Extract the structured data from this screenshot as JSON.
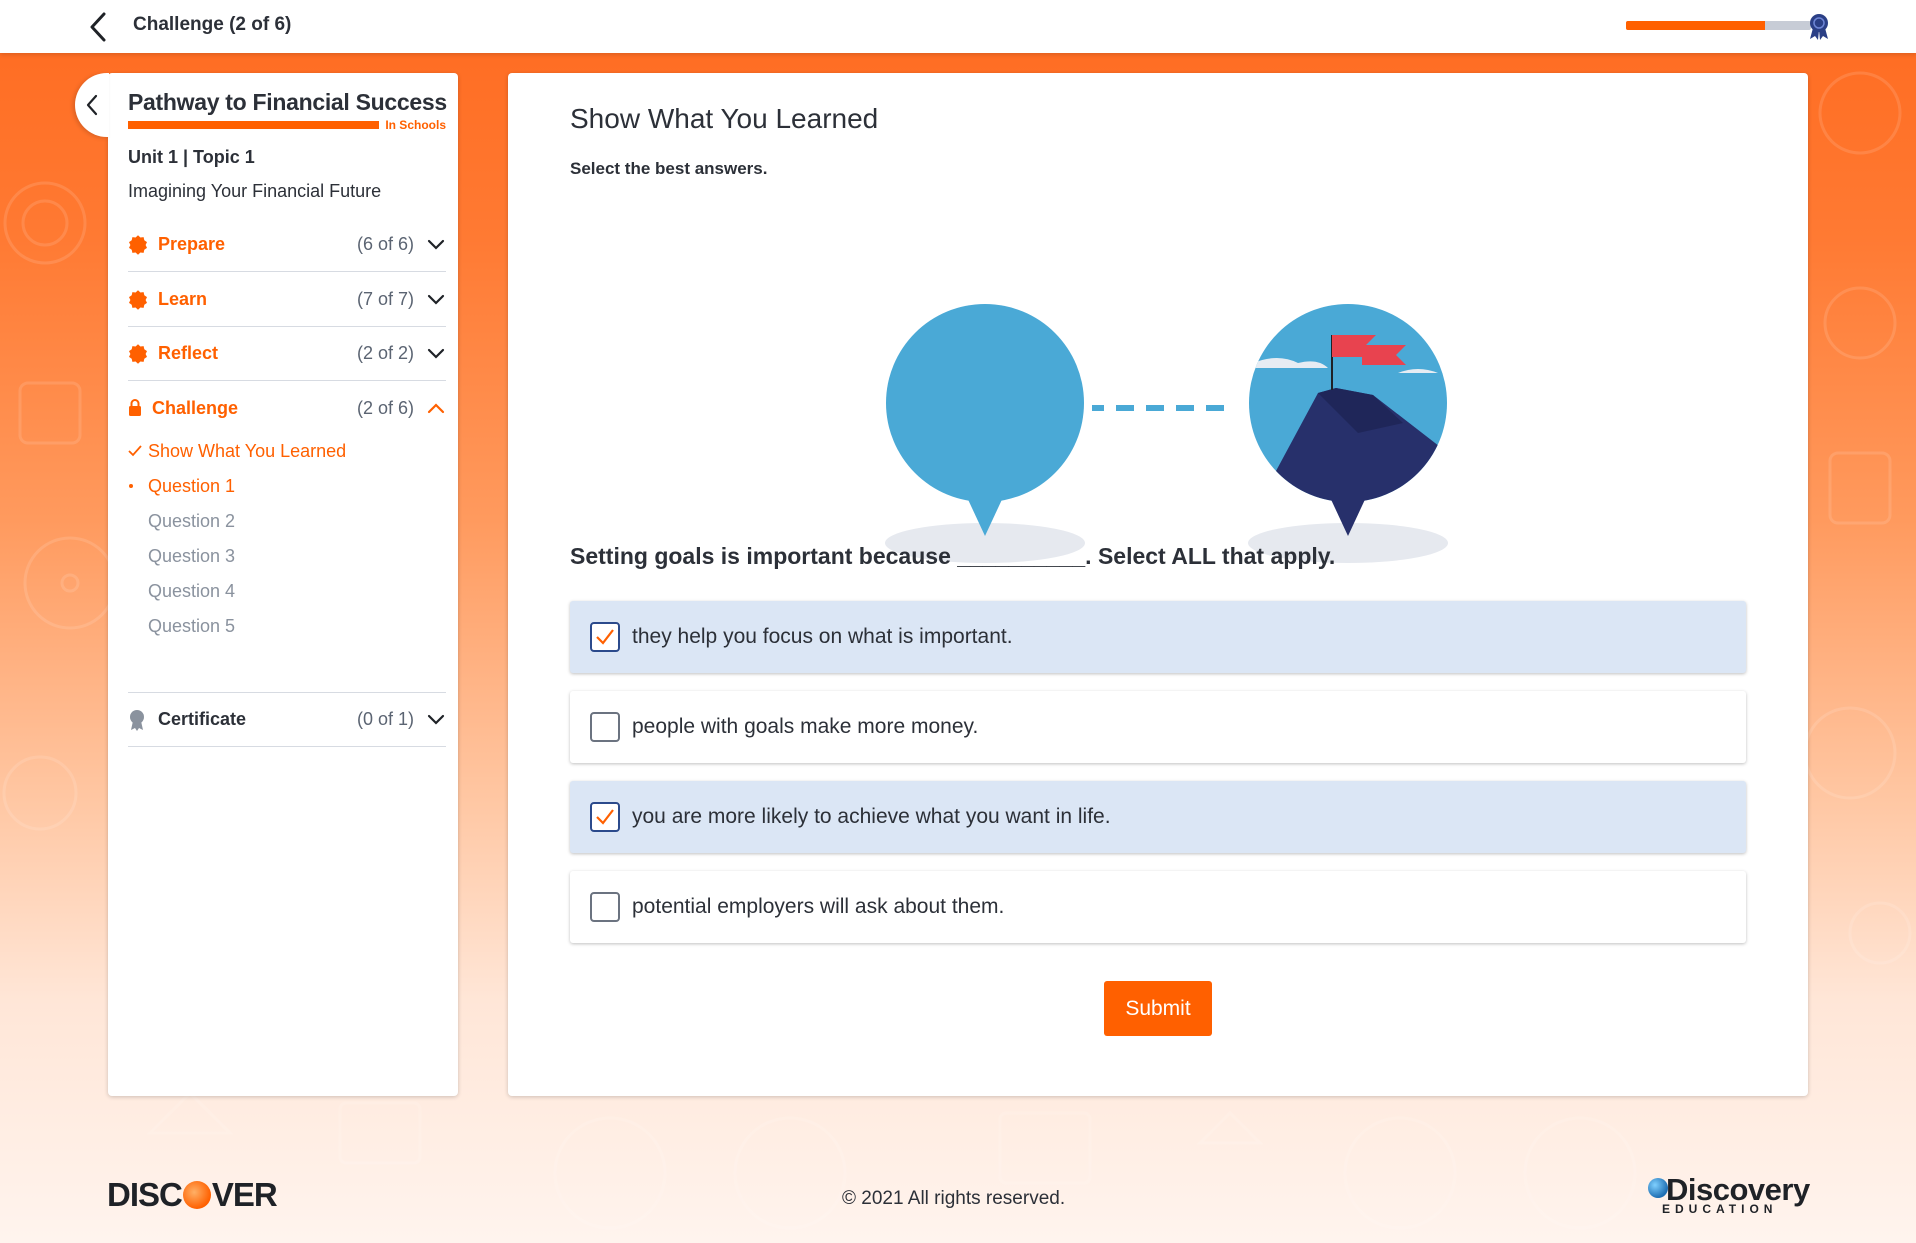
{
  "header": {
    "title": "Challenge (2 of 6)",
    "progress_fraction": 0.75
  },
  "sidebar": {
    "brand_title": "Pathway to Financial Success",
    "brand_sub": "In Schools",
    "unit_label": "Unit 1 | Topic 1",
    "topic_title": "Imagining Your Financial Future",
    "sections": [
      {
        "label": "Prepare",
        "count": "(6 of 6)",
        "icon": "badge-icon",
        "expanded": false
      },
      {
        "label": "Learn",
        "count": "(7 of 7)",
        "icon": "badge-icon",
        "expanded": false
      },
      {
        "label": "Reflect",
        "count": "(2 of 2)",
        "icon": "badge-icon",
        "expanded": false
      },
      {
        "label": "Challenge",
        "count": "(2 of 6)",
        "icon": "lock-icon",
        "expanded": true
      },
      {
        "label": "Certificate",
        "count": "(0 of 1)",
        "icon": "award-icon",
        "expanded": false
      }
    ],
    "challenge_items": [
      {
        "label": "Show What You Learned",
        "status": "complete"
      },
      {
        "label": "Question 1",
        "status": "current"
      },
      {
        "label": "Question 2",
        "status": "pending"
      },
      {
        "label": "Question 3",
        "status": "pending"
      },
      {
        "label": "Question 4",
        "status": "pending"
      },
      {
        "label": "Question 5",
        "status": "pending"
      }
    ]
  },
  "main": {
    "title": "Show What You Learned",
    "instruction": "Select the best answers.",
    "question": "Setting goals is important because __________. Select ALL that apply.",
    "options": [
      {
        "text": "they help you focus on what is important.",
        "checked": true
      },
      {
        "text": "people with goals make more money.",
        "checked": false
      },
      {
        "text": "you are more likely to achieve what you want in life.",
        "checked": true
      },
      {
        "text": "potential employers will ask about them.",
        "checked": false
      }
    ],
    "submit_label": "Submit"
  },
  "footer": {
    "copyright": "© 2021 All rights reserved.",
    "left_logo": "DISCOVER",
    "right_logo_main": "Discovery",
    "right_logo_sub": "EDUCATION"
  },
  "colors": {
    "accent": "#ff6000",
    "selected_bg": "#dbe6f5",
    "pin_blue": "#4aa9d6",
    "mountain_navy": "#27306b",
    "flag_red": "#e8434f"
  }
}
